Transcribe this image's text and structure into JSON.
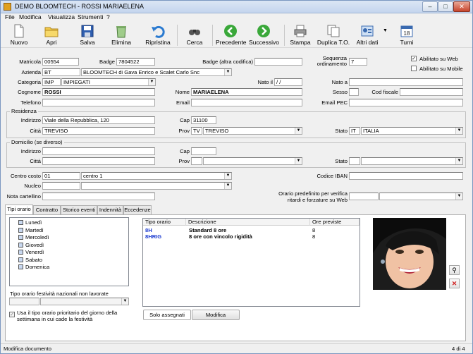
{
  "window": {
    "title": "DEMO BLOOMTECH - ROSSI MARIAELENA"
  },
  "menu": [
    "File",
    "Modifica",
    "Visualizza",
    "Strumenti",
    "?"
  ],
  "toolbar": {
    "nuovo": "Nuovo",
    "apri": "Apri",
    "salva": "Salva",
    "elimina": "Elimina",
    "ripristina": "Ripristina",
    "cerca": "Cerca",
    "precedente": "Precedente",
    "successivo": "Successivo",
    "stampa": "Stampa",
    "duplica": "Duplica T.O.",
    "altri": "Altri dati",
    "turni": "Turni"
  },
  "labels": {
    "matricola": "Matricola",
    "badge": "Badge",
    "badge_alt": "Badge (altra codifica)",
    "sequenza": "Sequenza ordinamento",
    "abilitato_web": "Abilitato su Web",
    "abilitato_mobile": "Abilitato su Mobile",
    "azienda": "Azienda",
    "categoria": "Categoria",
    "nato_il": "Nato il",
    "nato_a": "Nato a",
    "cognome": "Cognome",
    "nome": "Nome",
    "sesso": "Sesso",
    "cod_fiscale": "Cod fiscale",
    "telefono": "Telefono",
    "email": "Email",
    "email_pec": "Email PEC",
    "residenza": "Residenza",
    "indirizzo": "Indirizzo",
    "cap": "Cap",
    "citta": "Città",
    "prov": "Prov",
    "stato": "Stato",
    "domicilio": "Domicilio (se diverso)",
    "centro_costo": "Centro costo",
    "codice_iban": "Codice IBAN",
    "nucleo": "Nucleo",
    "nota": "Nota cartellino",
    "orario_pred": "Orario predefinito per verifica ritardi e forzature su Web"
  },
  "fields": {
    "matricola": "00554",
    "badge": "7804522",
    "badge_alt": "",
    "sequenza": "7",
    "azienda_code": "BT",
    "azienda_name": "BLOOMTECH di Gava Enrico e Scalet Carlo Snc",
    "categoria_code": "IMP",
    "categoria_name": "IMPIEGATI",
    "nato_il": " / /",
    "cognome": "ROSSI",
    "nome": "MARIAELENA",
    "res_indirizzo": "Viale della Repubblica, 120",
    "res_cap": "31100",
    "res_citta": "TREVISO",
    "res_prov": "TV",
    "res_prov_name": "TREVISO",
    "res_stato": "IT",
    "res_stato_name": "ITALIA",
    "centro_costo_code": "01",
    "centro_costo_name": "centro 1"
  },
  "tabs": [
    "Tipi orario",
    "Contratto",
    "Storico eventi",
    "Indennità",
    "Eccedenze"
  ],
  "days": [
    "Lunedì",
    "Martedì",
    "Mercoledì",
    "Giovedì",
    "Venerdì",
    "Sabato",
    "Domenica"
  ],
  "grid": {
    "headers": [
      "Tipo orario",
      "Descrizione",
      "Ore previste"
    ],
    "rows": [
      {
        "code": "8H",
        "desc": "Standard 8 ore",
        "ore": "8"
      },
      {
        "code": "8HRIG",
        "desc": "8 ore con vincolo rigidità",
        "ore": "8"
      }
    ]
  },
  "festivita_label": "Tipo orario festività nazionali non lavorate",
  "prioritario_label": "Usa il tipo orario prioritario del giorno della settimana in cui cade la festività",
  "buttons": {
    "solo_assegnati": "Solo assegnati",
    "modifica": "Modifica"
  },
  "status": {
    "left": "Modifica documento",
    "right": "4 di 4"
  }
}
